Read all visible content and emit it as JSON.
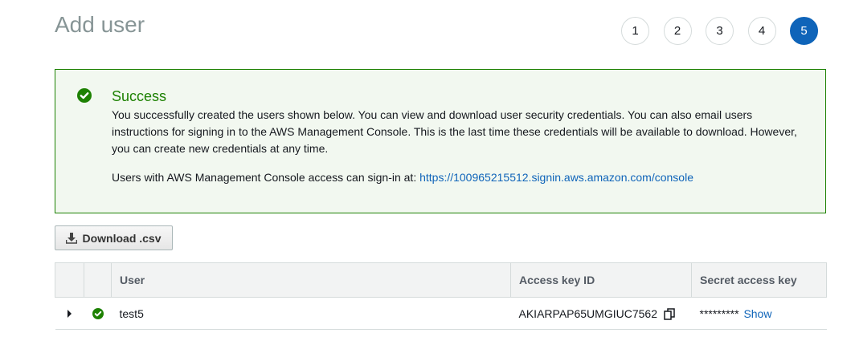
{
  "page": {
    "title": "Add user"
  },
  "steps": [
    "1",
    "2",
    "3",
    "4",
    "5"
  ],
  "active_step": "5",
  "alert": {
    "icon": "check-circle-icon",
    "title": "Success",
    "body": "You successfully created the users shown below. You can view and download user security credentials. You can also email users instructions for signing in to the AWS Management Console. This is the last time these credentials will be available to download. However, you can create new credentials at any time.",
    "signin_text": "Users with AWS Management Console access can sign-in at: ",
    "signin_url": "https://100965215512.signin.aws.amazon.com/console"
  },
  "download": {
    "label": "Download .csv",
    "icon": "download-icon"
  },
  "table": {
    "columns": {
      "user": "User",
      "access_key": "Access key ID",
      "secret": "Secret access key"
    },
    "rows": [
      {
        "user": "test5",
        "access_key": "AKIARPAP65UMGIUC7562",
        "secret_masked": "*********",
        "show_label": "Show"
      }
    ]
  },
  "colors": {
    "success": "#1d8102",
    "accent": "#0f64b9",
    "title": "#879596"
  }
}
